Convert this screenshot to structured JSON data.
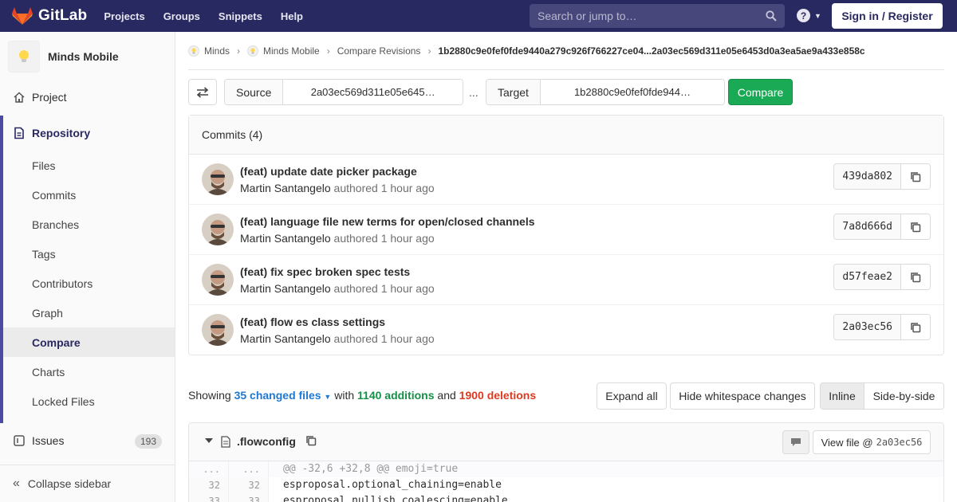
{
  "navbar": {
    "brand": "GitLab",
    "links": [
      "Projects",
      "Groups",
      "Snippets",
      "Help"
    ],
    "search_placeholder": "Search or jump to…",
    "signin": "Sign in / Register"
  },
  "sidebar": {
    "project_name": "Minds Mobile",
    "project": "Project",
    "repository": "Repository",
    "repo_items": [
      "Files",
      "Commits",
      "Branches",
      "Tags",
      "Contributors",
      "Graph",
      "Compare",
      "Charts",
      "Locked Files"
    ],
    "active_item": "Compare",
    "issues": "Issues",
    "issues_count": "193",
    "collapse": "Collapse sidebar"
  },
  "breadcrumb": {
    "items": [
      "Minds",
      "Minds Mobile",
      "Compare Revisions"
    ],
    "current": "1b2880c9e0fef0fde9440a279c926f766227ce04...2a03ec569d311e05e6453d0a3ea5ae9a433e858c"
  },
  "compare": {
    "source_label": "Source",
    "source_value": "2a03ec569d311e05e645…",
    "dots": "...",
    "target_label": "Target",
    "target_value": "1b2880c9e0fef0fde944…",
    "compare_button": "Compare"
  },
  "commits": {
    "header": "Commits (4)",
    "authored": "authored",
    "list": [
      {
        "title": "(feat) update date picker package",
        "author": "Martin Santangelo",
        "time": "1 hour ago",
        "sha": "439da802"
      },
      {
        "title": "(feat) language file new terms for open/closed channels",
        "author": "Martin Santangelo",
        "time": "1 hour ago",
        "sha": "7a8d666d"
      },
      {
        "title": "(feat) fix spec broken spec tests",
        "author": "Martin Santangelo",
        "time": "1 hour ago",
        "sha": "d57feae2"
      },
      {
        "title": "(feat) flow es class settings",
        "author": "Martin Santangelo",
        "time": "1 hour ago",
        "sha": "2a03ec56"
      }
    ]
  },
  "summary": {
    "showing": "Showing",
    "files": "35 changed files",
    "with": "with",
    "additions": "1140 additions",
    "and": "and",
    "deletions": "1900 deletions"
  },
  "buttons": {
    "expand_all": "Expand all",
    "hide_whitespace": "Hide whitespace changes",
    "inline": "Inline",
    "side_by_side": "Side-by-side"
  },
  "diff": {
    "file_name": ".flowconfig",
    "view_file": "View file @",
    "view_sha": "2a03ec56",
    "lines": [
      {
        "old": "...",
        "new": "...",
        "code": "@@ -32,6 +32,8 @@ emoji=true",
        "hunk": true
      },
      {
        "old": "32",
        "new": "32",
        "code": "esproposal.optional_chaining=enable",
        "hunk": false
      },
      {
        "old": "33",
        "new": "33",
        "code": "esproposal.nullish_coalescing=enable",
        "hunk": false
      }
    ]
  },
  "colors": {
    "navbar": "#292961",
    "accent": "#4b4ba3",
    "compare_button": "#1aaa55",
    "additions": "#168f48",
    "deletions": "#db3b21",
    "link": "#1f78d1"
  }
}
